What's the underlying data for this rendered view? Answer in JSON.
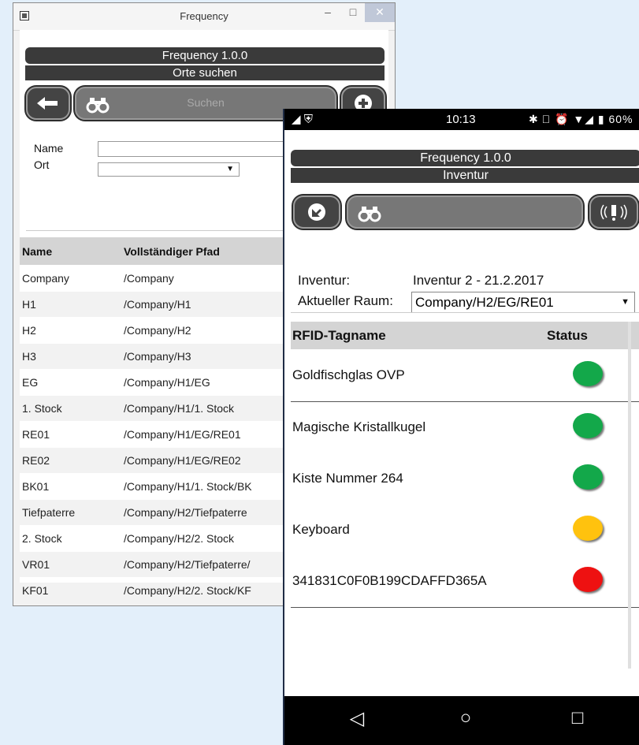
{
  "desktop": {
    "window_title": "Frequency",
    "app_title": "Frequency 1.0.0",
    "page_title": "Orte suchen",
    "search_button_label": "Suchen",
    "form": {
      "name_label": "Name",
      "name_value": "",
      "ort_label": "Ort",
      "ort_value": ""
    },
    "table": {
      "headers": [
        "Name",
        "Vollständiger Pfad"
      ],
      "rows": [
        {
          "name": "Company",
          "path": "/Company"
        },
        {
          "name": "H1",
          "path": "/Company/H1"
        },
        {
          "name": "H2",
          "path": "/Company/H2"
        },
        {
          "name": "H3",
          "path": "/Company/H3"
        },
        {
          "name": "EG",
          "path": "/Company/H1/EG"
        },
        {
          "name": "1. Stock",
          "path": "/Company/H1/1. Stock"
        },
        {
          "name": "RE01",
          "path": "/Company/H1/EG/RE01"
        },
        {
          "name": "RE02",
          "path": "/Company/H1/EG/RE02"
        },
        {
          "name": "BK01",
          "path": "/Company/H1/1. Stock/BK"
        },
        {
          "name": "Tiefpaterre",
          "path": "/Company/H2/Tiefpaterre"
        },
        {
          "name": "2. Stock",
          "path": "/Company/H2/2. Stock"
        },
        {
          "name": "VR01",
          "path": "/Company/H2/Tiefpaterre/"
        },
        {
          "name": "KF01",
          "path": "/Company/H2/2. Stock/KF"
        }
      ]
    }
  },
  "mobile": {
    "status_bar": {
      "time": "10:13",
      "battery": "60%",
      "left_icons": "◢ ⛨",
      "right_icons": "✱ ⃠ ⏰ ▼◢ ▮"
    },
    "app_title": "Frequency 1.0.0",
    "page_title": "Inventur",
    "inventur_label": "Inventur:",
    "inventur_value": "Inventur 2 - 21.2.2017",
    "room_label": "Aktueller Raum:",
    "room_value": "Company/H2/EG/RE01",
    "table": {
      "headers": [
        "RFID-Tagname",
        "Status"
      ],
      "rows": [
        {
          "name": "Goldfischglas OVP",
          "status_color": "#13a84a"
        },
        {
          "name": "Magische Kristallkugel",
          "status_color": "#13a84a"
        },
        {
          "name": "Kiste Nummer 264",
          "status_color": "#13a84a"
        },
        {
          "name": "Keyboard",
          "status_color": "#ffc20e"
        },
        {
          "name": "341831C0F0B199CDAFFD365A",
          "status_color": "#ee1111"
        }
      ]
    },
    "nav": {
      "back": "◁",
      "home": "○",
      "recents": "□"
    }
  }
}
